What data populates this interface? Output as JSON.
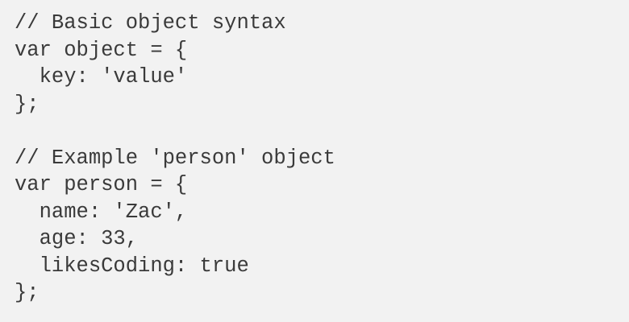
{
  "code": {
    "lines": [
      "// Basic object syntax",
      "var object = {",
      "  key: 'value'",
      "};",
      "",
      "// Example 'person' object",
      "var person = {",
      "  name: 'Zac',",
      "  age: 33,",
      "  likesCoding: true",
      "};"
    ]
  },
  "colors": {
    "background": "#f2f2f2",
    "text": "#3a3a3a"
  }
}
